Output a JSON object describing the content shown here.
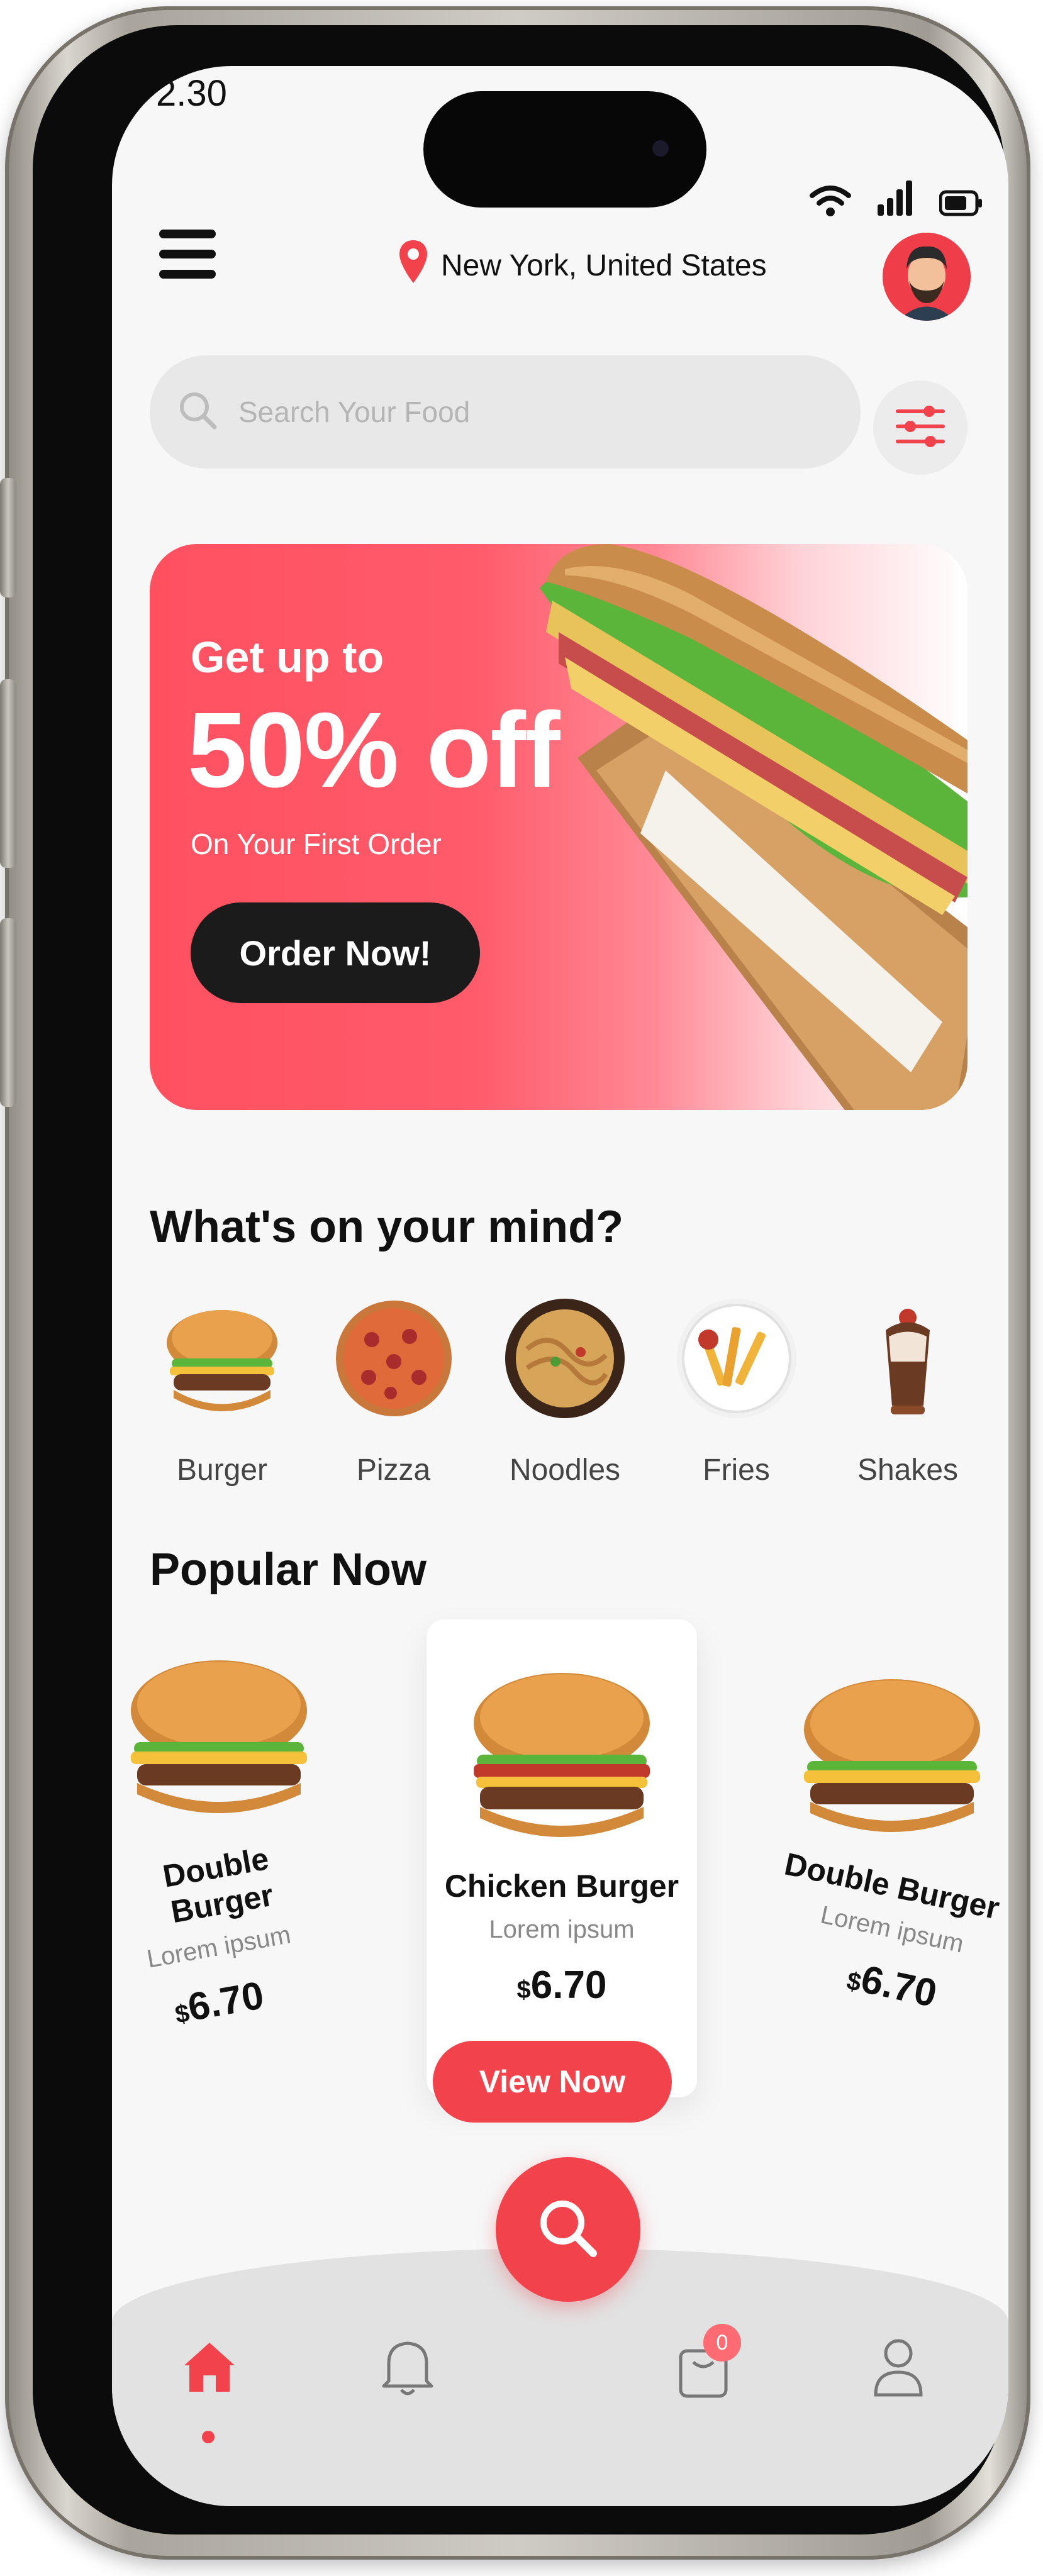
{
  "status_bar": {
    "time": "2.30"
  },
  "header": {
    "location": "New York, United States"
  },
  "search": {
    "placeholder": "Search Your Food"
  },
  "promo": {
    "line1": "Get up to",
    "headline": "50% off",
    "subtitle": "On Your First Order",
    "button_label": "Order Now!"
  },
  "categories": {
    "title": "What's on your mind?",
    "items": [
      {
        "label": "Burger"
      },
      {
        "label": "Pizza"
      },
      {
        "label": "Noodles"
      },
      {
        "label": "Fries"
      },
      {
        "label": "Shakes"
      }
    ]
  },
  "popular": {
    "title": "Popular Now",
    "items": [
      {
        "name": "Double Burger",
        "desc": "Lorem ipsum",
        "currency": "$",
        "price": "6.70"
      },
      {
        "name": "Chicken Burger",
        "desc": "Lorem ipsum",
        "currency": "$",
        "price": "6.70"
      },
      {
        "name": "Double Burger",
        "desc": "Lorem ipsum",
        "currency": "$",
        "price": "6.70"
      }
    ],
    "view_button": "View Now"
  },
  "bottom_nav": {
    "cart_badge": "0"
  },
  "colors": {
    "accent": "#f2434d",
    "promo": "#ff5060",
    "dark_button": "#1b1b1b"
  },
  "icons": [
    "menu-icon",
    "location-pin-icon",
    "avatar",
    "search-icon",
    "filter-icon",
    "home-icon",
    "bell-icon",
    "cart-icon",
    "profile-icon"
  ]
}
